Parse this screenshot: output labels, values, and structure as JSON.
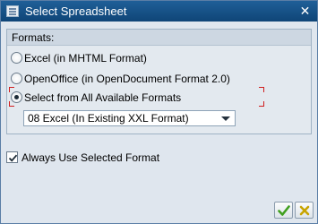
{
  "window": {
    "title": "Select Spreadsheet"
  },
  "formats": {
    "group_title": "Formats:",
    "options": [
      {
        "label": "Excel (in MHTML Format)",
        "checked": false
      },
      {
        "label": "OpenOffice (in OpenDocument Format 2.0)",
        "checked": false
      },
      {
        "label": "Select from All Available Formats",
        "checked": true
      }
    ],
    "format_select": {
      "value": "08 Excel (In Existing XXL Format)"
    }
  },
  "always_use": {
    "label": "Always Use Selected Format",
    "checked": true
  },
  "buttons": {
    "confirm_icon": "checkmark-icon",
    "cancel_icon": "cancel-x-icon"
  },
  "colors": {
    "titlebar": "#1f5f98",
    "confirm": "#3f9f1f",
    "cancel": "#c8a400",
    "focus_marker": "#d01e1e"
  }
}
